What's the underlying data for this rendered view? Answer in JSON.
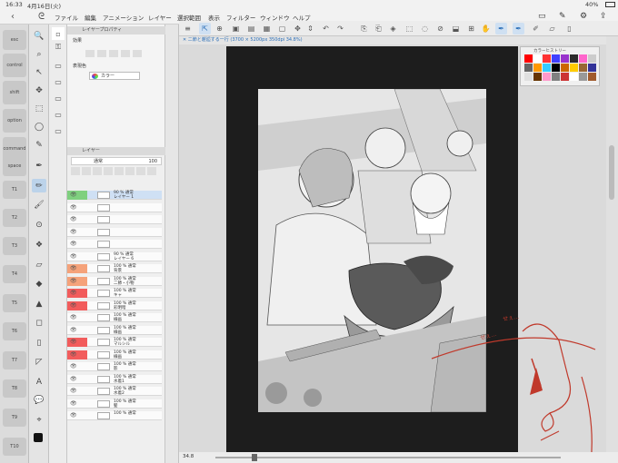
{
  "status": {
    "time": "16:33",
    "date": "4月16日(火)",
    "battery": "40%"
  },
  "menu": [
    "ファイル",
    "編集",
    "アニメーション",
    "レイヤー",
    "選択範囲",
    "表示",
    "フィルター",
    "ウィンドウ",
    "ヘルプ"
  ],
  "edge_buttons": [
    "esc",
    "control",
    "shift",
    "option",
    "command",
    "space",
    "T1",
    "T2",
    "T3",
    "T4",
    "T5",
    "T6",
    "T7",
    "T8",
    "T9",
    "T10"
  ],
  "property_panel": {
    "title": "レイヤープロパティ",
    "effect_label": "効果",
    "color_label": "表現色",
    "color_value": "カラー"
  },
  "layer_panel": {
    "title": "レイヤー",
    "blend_mode": "通常",
    "opacity": "100"
  },
  "layers": [
    {
      "name": "90 % 通常\nレイヤー 1",
      "swatch": "#7fd07f",
      "selected": true
    },
    {
      "name": "",
      "swatch": "",
      "selected": false
    },
    {
      "name": "",
      "swatch": "",
      "selected": false
    },
    {
      "name": "",
      "swatch": "",
      "selected": false
    },
    {
      "name": "",
      "swatch": "",
      "selected": false
    },
    {
      "name": "90 % 通常\nレイヤー 6",
      "swatch": "",
      "selected": false
    },
    {
      "name": "100 % 通常\n背景",
      "swatch": "#f5a27a",
      "selected": false
    },
    {
      "name": "100 % 通常\n二節・小物",
      "swatch": "#f5a27a",
      "selected": false
    },
    {
      "name": "100 % 通常\nキャ",
      "swatch": "#f25c5c",
      "selected": false
    },
    {
      "name": "100 % 通常\n彩明暗",
      "swatch": "#f25c5c",
      "selected": false
    },
    {
      "name": "100 % 通常\n線画",
      "swatch": "",
      "selected": false
    },
    {
      "name": "100 % 通常\n線画",
      "swatch": "",
      "selected": false
    },
    {
      "name": "100 % 通常\nマルシル",
      "swatch": "#f25c5c",
      "selected": false
    },
    {
      "name": "100 % 通常\n線画",
      "swatch": "#f25c5c",
      "selected": false
    },
    {
      "name": "100 % 通常\n影",
      "swatch": "",
      "selected": false
    },
    {
      "name": "100 % 通常\n水着1",
      "swatch": "",
      "selected": false
    },
    {
      "name": "100 % 通常\n水着2",
      "swatch": "",
      "selected": false
    },
    {
      "name": "100 % 通常\n髪",
      "swatch": "",
      "selected": false
    },
    {
      "name": "100 % 通常",
      "swatch": "",
      "selected": false
    }
  ],
  "canvas_tab": "二節と邂逅する一行 (3700 × 5200px 350dpi 34.8%)",
  "zoom": "34.8",
  "color_history": {
    "title": "カラーヒストリー",
    "colors": [
      "#ff0000",
      "#ffffff",
      "#ff3333",
      "#4040ff",
      "#9933cc",
      "#2b2b2b",
      "#ff66cc",
      "#cccccc",
      "#666666",
      "#ff9900",
      "#33ccff",
      "#000000",
      "#cc6600",
      "#ffcc00",
      "#996633",
      "#333399",
      "#e0e0e0",
      "#663300",
      "#ff99cc",
      "#808080",
      "#cc3333",
      "#ffffff",
      "#999999",
      "#a05a2c"
    ]
  },
  "scribble_text": "せぇ…"
}
